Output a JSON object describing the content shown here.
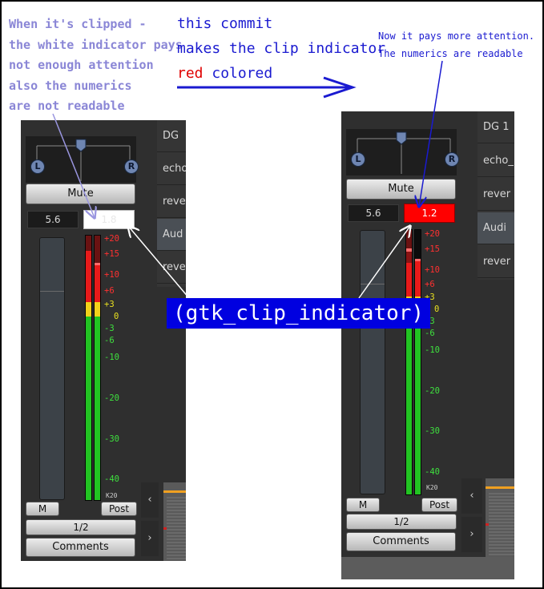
{
  "annotations": {
    "left": [
      "When it's clipped -",
      "the white indicator pays",
      "not enough attention",
      "also the numerics",
      "are not readable"
    ],
    "middle": {
      "line1": "this commit",
      "line2": "makes the clip indicator",
      "line3_red": "red",
      "line3_rest": " colored"
    },
    "right": [
      "Now it pays more attention.",
      "The numerics are readable"
    ],
    "callout": "(gtk_clip_indicator)"
  },
  "before": {
    "pan_left": "L",
    "pan_right": "R",
    "mute_label": "Mute",
    "gain_value": "5.6",
    "peak_value": "1.8",
    "peak_style": "white",
    "meter_ticks": [
      "+20",
      "+15",
      "+10",
      "+6",
      "+3",
      "0",
      "-3",
      "-6",
      "-10",
      "-20",
      "-30",
      "-40"
    ],
    "meter_type": "K20",
    "m_label": "M",
    "post_label": "Post",
    "input_label": "1/2",
    "comments_label": "Comments",
    "list_items": [
      "DG",
      "echo",
      "reve",
      "Aud",
      "reve"
    ],
    "nav_prev": "‹",
    "nav_next": "›"
  },
  "after": {
    "pan_left": "L",
    "pan_right": "R",
    "mute_label": "Mute",
    "gain_value": "5.6",
    "peak_value": "1.2",
    "peak_style": "red",
    "meter_ticks": [
      "+20",
      "+15",
      "+10",
      "+6",
      "+3",
      "0",
      "-3",
      "-6",
      "-10",
      "-20",
      "-30",
      "-40"
    ],
    "meter_type": "K20",
    "m_label": "M",
    "post_label": "Post",
    "input_label": "1/2",
    "comments_label": "Comments",
    "list_items": [
      "DG 1",
      "echo_",
      "rever",
      "Audi",
      "rever"
    ],
    "nav_prev": "‹",
    "nav_next": "›"
  },
  "colors": {
    "clip_red": "#ff0000",
    "clip_white": "#ffffff",
    "annotation_blue": "#1a1ad0",
    "annotation_light": "#8a86d6",
    "meter_green": "#22c422",
    "meter_yellow": "#f2d21a",
    "meter_red": "#e81a1a"
  }
}
